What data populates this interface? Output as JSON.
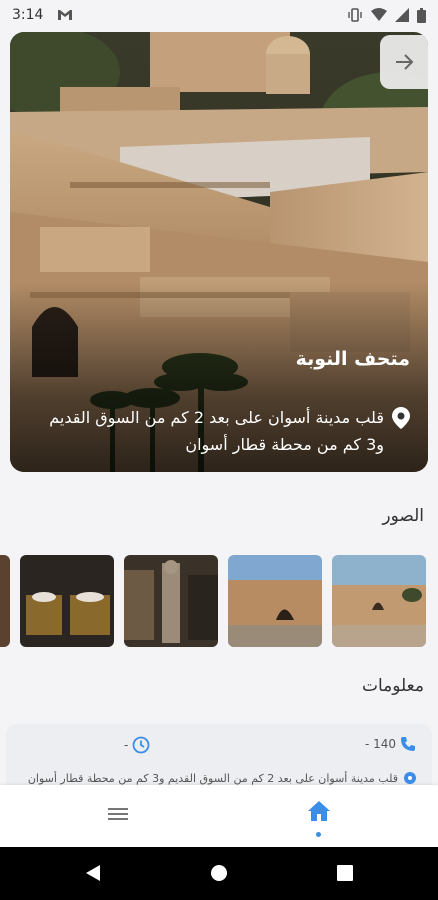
{
  "status": {
    "time": "3:14"
  },
  "hero": {
    "title": "متحف النوبة",
    "location": "قلب مدينة أسوان على بعد 2 كم من السوق القديم و3 كم من محطة قطار أسوان"
  },
  "sections": {
    "photos_title": "الصور",
    "info_title": "معلومات"
  },
  "info": {
    "phone": "140 -",
    "hours": "-",
    "address": "قلب مدينة أسوان على بعد 2 كم من السوق القديم و3 كم من محطة قطار أسوان"
  },
  "colors": {
    "accent": "#3b8ee8",
    "background": "#f4f4f6",
    "card": "#eceef2"
  },
  "icons": {
    "next": "arrow-right-icon",
    "location": "location-pin-icon",
    "phone": "phone-icon",
    "clock": "clock-icon",
    "menu": "menu-icon",
    "home": "home-icon"
  }
}
